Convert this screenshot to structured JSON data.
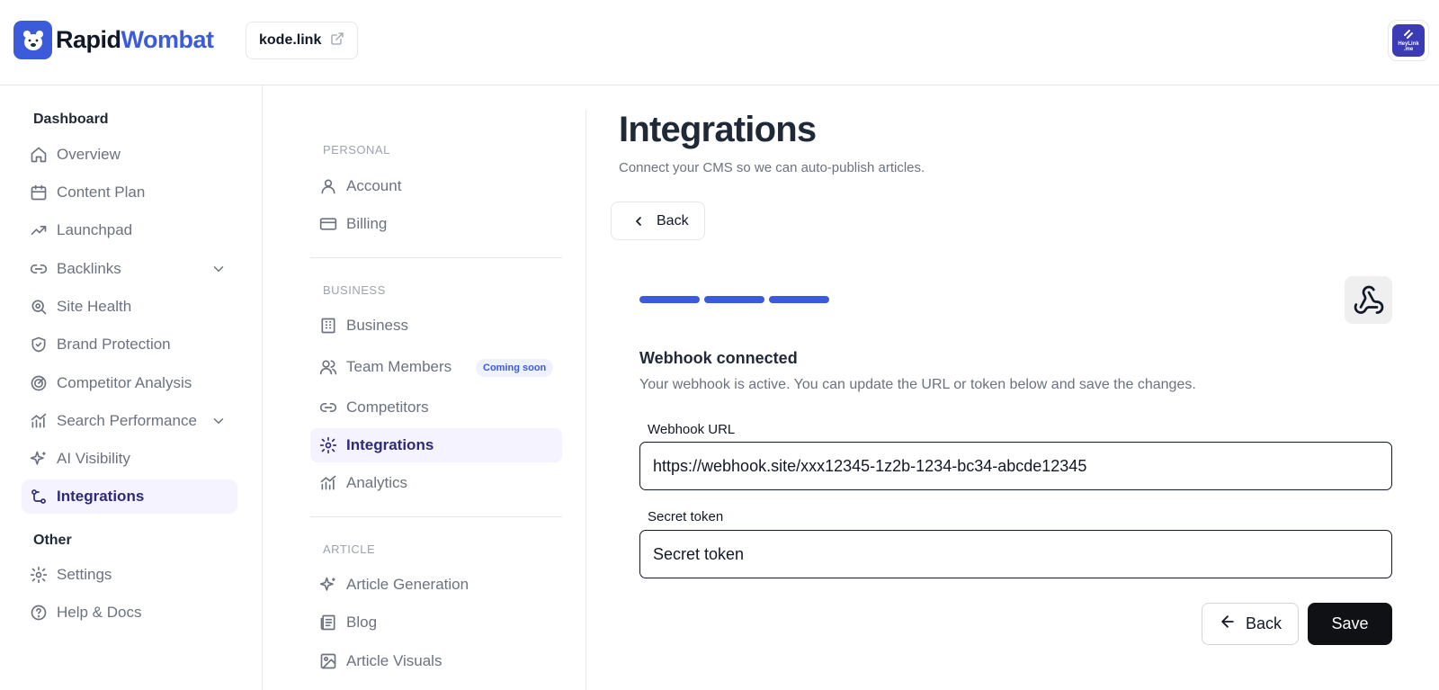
{
  "header": {
    "logo": {
      "part1": "Rapid",
      "part2": "Wombat"
    },
    "site": "kode.link",
    "avatar_text": "HeyLink\n.me"
  },
  "sidebar": {
    "sections": [
      {
        "title": "Dashboard"
      },
      {
        "title": "Other"
      }
    ],
    "items": [
      {
        "label": "Overview",
        "icon": "home-icon"
      },
      {
        "label": "Content Plan",
        "icon": "calendar-icon"
      },
      {
        "label": "Launchpad",
        "icon": "trending-up-icon"
      },
      {
        "label": "Backlinks",
        "icon": "link-icon",
        "expandable": true
      },
      {
        "label": "Site Health",
        "icon": "search-zoom-icon"
      },
      {
        "label": "Brand Protection",
        "icon": "shield-check-icon"
      },
      {
        "label": "Competitor Analysis",
        "icon": "radar-icon"
      },
      {
        "label": "Search Performance",
        "icon": "chart-icon",
        "expandable": true
      },
      {
        "label": "AI Visibility",
        "icon": "sparkles-icon"
      },
      {
        "label": "Integrations",
        "icon": "integration-icon",
        "active": true
      },
      {
        "label": "Settings",
        "icon": "gear-icon"
      },
      {
        "label": "Help & Docs",
        "icon": "help-circle-icon"
      }
    ]
  },
  "settings_nav": {
    "sections": [
      "PERSONAL",
      "BUSINESS",
      "ARTICLE"
    ],
    "items": [
      {
        "label": "Account",
        "icon": "user-icon"
      },
      {
        "label": "Billing",
        "icon": "credit-card-icon"
      },
      {
        "label": "Business",
        "icon": "building-icon"
      },
      {
        "label": "Team Members",
        "icon": "users-icon",
        "badge": "Coming soon"
      },
      {
        "label": "Competitors",
        "icon": "link-icon"
      },
      {
        "label": "Integrations",
        "icon": "gear-icon",
        "active": true
      },
      {
        "label": "Analytics",
        "icon": "chart-icon"
      },
      {
        "label": "Article Generation",
        "icon": "sparkles-icon"
      },
      {
        "label": "Blog",
        "icon": "newspaper-icon"
      },
      {
        "label": "Article Visuals",
        "icon": "image-icon"
      }
    ]
  },
  "main": {
    "title": "Integrations",
    "subtitle": "Connect your CMS so we can auto-publish articles.",
    "back_label": "Back",
    "steps_completed": 3,
    "steps_total": 3,
    "card": {
      "title": "Webhook connected",
      "description": "Your webhook is active. You can update the URL or token below and save the changes.",
      "webhook_label": "Webhook URL",
      "webhook_value": "https://webhook.site/xxx12345-1z2b-1234-bc34-abcde12345",
      "token_label": "Secret token",
      "token_placeholder": "Secret token",
      "back_label": "Back",
      "save_label": "Save"
    }
  },
  "colors": {
    "accent": "#3b5bdb",
    "active_bg": "#f5f3ff",
    "active_text": "#2e2a7a",
    "primary_button": "#0f1115"
  }
}
